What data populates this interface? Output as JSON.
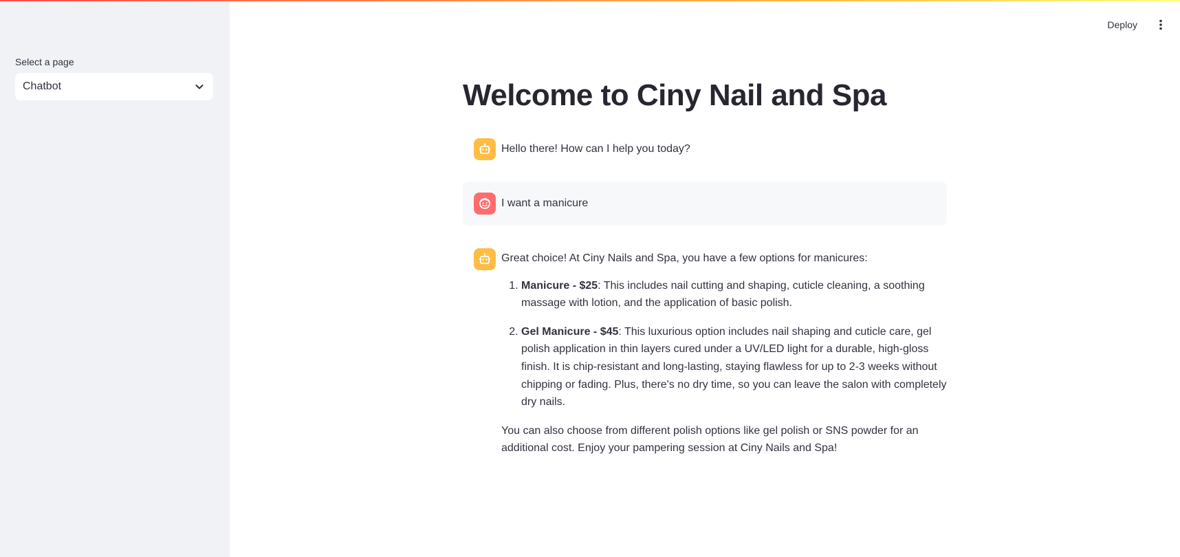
{
  "sidebar": {
    "label": "Select a page",
    "selected_page": "Chatbot"
  },
  "header": {
    "deploy_label": "Deploy"
  },
  "main": {
    "title": "Welcome to Ciny Nail and Spa",
    "messages": [
      {
        "role": "assistant",
        "text": "Hello there! How can I help you today?"
      },
      {
        "role": "user",
        "text": "I want a manicure"
      },
      {
        "role": "assistant",
        "intro": "Great choice! At Ciny Nails and Spa, you have a few options for manicures:",
        "options": [
          {
            "name": "Manicure - $25",
            "desc": ": This includes nail cutting and shaping, cuticle cleaning, a soothing massage with lotion, and the application of basic polish."
          },
          {
            "name": "Gel Manicure - $45",
            "desc": ": This luxurious option includes nail shaping and cuticle care, gel polish application in thin layers cured under a UV/LED light for a durable, high-gloss finish. It is chip-resistant and long-lasting, staying flawless for up to 2-3 weeks without chipping or fading. Plus, there's no dry time, so you can leave the salon with completely dry nails."
          }
        ],
        "outro": "You can also choose from different polish options like gel polish or SNS powder for an additional cost. Enjoy your pampering session at Ciny Nails and Spa!"
      }
    ]
  },
  "colors": {
    "accent_gradient_start": "#ff4b4b",
    "accent_gradient_end": "#fffd80",
    "bot_avatar": "#ffbd45",
    "user_avatar": "#ff6c6c",
    "sidebar_bg": "#f0f2f6"
  },
  "icons": {
    "bot_avatar": "robot-icon",
    "user_avatar": "smiley-face-icon",
    "select_toggle": "chevron-down-icon",
    "menu": "kebab-menu-icon"
  }
}
